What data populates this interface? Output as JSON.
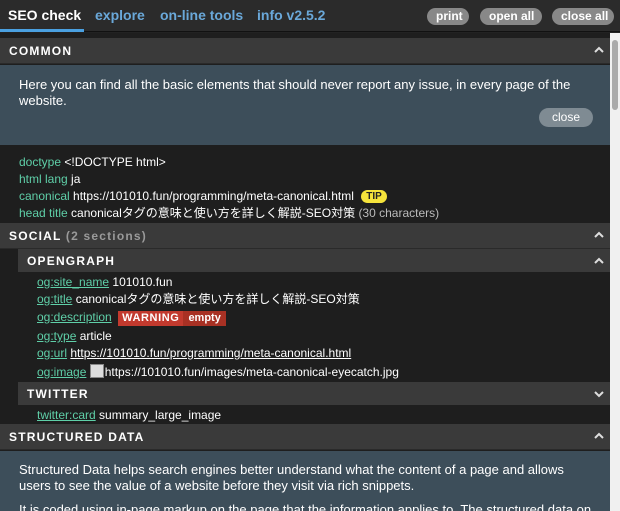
{
  "tabs": [
    {
      "label": "SEO check",
      "active": true
    },
    {
      "label": "explore"
    },
    {
      "label": "on-line tools"
    },
    {
      "label": "info v2.5.2"
    }
  ],
  "buttons": {
    "print": "print",
    "open_all": "open all",
    "close_all": "close all"
  },
  "common": {
    "title": "COMMON",
    "description": "Here you can find all the basic elements that should never report any issue, in every page of the website.",
    "close": "close",
    "rows": [
      {
        "key": "doctype",
        "value": "<!DOCTYPE html>"
      },
      {
        "key": "html lang",
        "value": "ja"
      },
      {
        "key": "canonical",
        "value": "https://101010.fun/programming/meta-canonical.html",
        "badge": "TIP"
      },
      {
        "key": "head title",
        "value": "canonicalタグの意味と使い方を詳しく解説-SEO対策",
        "meta": "(30 characters)"
      }
    ]
  },
  "social": {
    "title": "SOCIAL",
    "count": "(2 sections)",
    "opengraph": {
      "title": "OPENGRAPH",
      "rows": [
        {
          "key": "og:site_name",
          "value": "101010.fun"
        },
        {
          "key": "og:title",
          "value": "canonicalタグの意味と使い方を詳しく解説-SEO対策"
        },
        {
          "key": "og:description",
          "warning": "WARNING",
          "warning_detail": "empty"
        },
        {
          "key": "og:type",
          "value": "article"
        },
        {
          "key": "og:url",
          "value": "https://101010.fun/programming/meta-canonical.html"
        },
        {
          "key": "og:image",
          "value": "https://101010.fun/images/meta-canonical-eyecatch.jpg"
        }
      ]
    },
    "twitter": {
      "title": "TWITTER",
      "rows": [
        {
          "key": "twitter:card",
          "value": "summary_large_image"
        }
      ]
    }
  },
  "structured": {
    "title": "STRUCTURED DATA",
    "description": "Structured Data helps search engines better understand what the content of a page and allows users to see the value of a website before they visit via rich snippets.",
    "description2": "It is coded using in-page markup on the page that the information applies to. The structured data on the"
  },
  "colors": {
    "accent": "#4aa0e0",
    "key": "#5fcfa8",
    "tip": "#f5e33b",
    "warning": "#c23a2e",
    "infobox": "#3d4e5a"
  }
}
